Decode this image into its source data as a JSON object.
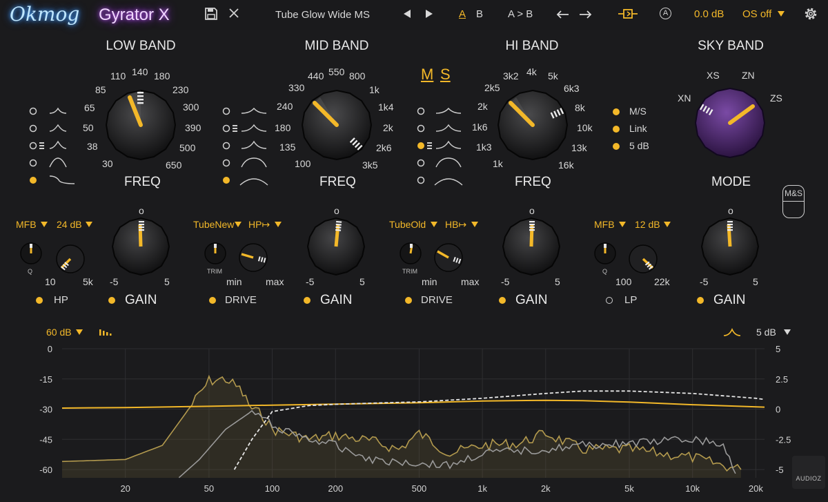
{
  "header": {
    "logo": "Okmog",
    "product": "Gyrator X",
    "preset": "Tube Glow Wide MS",
    "ab_a": "A",
    "ab_b": "B",
    "ab_copy": "A > B",
    "output": "0.0 dB",
    "os": "OS off",
    "auto_badge": "A"
  },
  "ms": {
    "m": "M",
    "s": "S"
  },
  "low": {
    "title": "LOW BAND",
    "freq_label": "FREQ",
    "freq_ticks": [
      "30",
      "38",
      "50",
      "65",
      "85",
      "110",
      "140",
      "180",
      "230",
      "300",
      "390",
      "500",
      "650"
    ],
    "filter_mode": "MFB",
    "slope": "24 dB",
    "hp_min": "10",
    "hp_max": "5k",
    "q_label": "Q",
    "hp_label": "HP",
    "gain_label": "GAIN",
    "gain_min": "-5",
    "gain_max": "5",
    "gain_center": "o"
  },
  "mid": {
    "title": "MID BAND",
    "freq_label": "FREQ",
    "freq_ticks": [
      "100",
      "135",
      "180",
      "240",
      "330",
      "440",
      "550",
      "800",
      "1k",
      "1k4",
      "2k",
      "2k6",
      "3k5"
    ],
    "tube": "TubeNew",
    "hp_mode": "HP↦",
    "trim": "TRIM",
    "drive_min": "min",
    "drive_max": "max",
    "drive_label": "DRIVE",
    "gain_label": "GAIN",
    "gain_min": "-5",
    "gain_max": "5",
    "gain_center": "o"
  },
  "hi": {
    "title": "HI BAND",
    "freq_label": "FREQ",
    "freq_ticks": [
      "1k",
      "1k3",
      "1k6",
      "2k",
      "2k5",
      "3k2",
      "4k",
      "5k",
      "6k3",
      "8k",
      "10k",
      "13k",
      "16k"
    ],
    "tube": "TubeOld",
    "hb_mode": "HB↦",
    "trim": "TRIM",
    "drive_min": "min",
    "drive_max": "max",
    "drive_label": "DRIVE",
    "gain_label": "GAIN",
    "gain_min": "-5",
    "gain_max": "5",
    "gain_center": "o"
  },
  "sky": {
    "title": "SKY BAND",
    "mode_label": "MODE",
    "modes": [
      "XN",
      "XS",
      "ZN",
      "ZS"
    ],
    "opts": [
      "M/S",
      "Link",
      "5 dB"
    ],
    "filter_mode": "MFB",
    "slope": "12 dB",
    "lp_min": "100",
    "lp_max": "22k",
    "q_label": "Q",
    "lp_label": "LP",
    "gain_label": "GAIN",
    "gain_min": "-5",
    "gain_max": "5",
    "gain_center": "o"
  },
  "ms_button": {
    "m": "M",
    "amp": "&",
    "s": "S"
  },
  "graph": {
    "range": "60 dB",
    "eq_range": "5 dB",
    "watermark": "AUDIOZ"
  },
  "chart_data": {
    "type": "line",
    "title": "",
    "xlabel": "",
    "ylabel": "",
    "x_scale": "log",
    "x_ticks": [
      "20",
      "50",
      "100",
      "200",
      "500",
      "1k",
      "2k",
      "5k",
      "10k",
      "20k"
    ],
    "y_left_ticks": [
      "0",
      "-15",
      "-30",
      "-45",
      "-60"
    ],
    "y_right_ticks": [
      "5",
      "2.5",
      "0",
      "-2.5",
      "-5"
    ],
    "ylim_left": [
      -60,
      0
    ],
    "ylim_right": [
      -5,
      5
    ],
    "grid": true,
    "colors": {
      "eq_curve": "#f3b829",
      "spectrum_in": "#b39a4e",
      "spectrum_out": "#9a9a9a",
      "hp_curve": "#e6e6e6"
    },
    "series": [
      {
        "x": [
          10,
          20,
          50,
          100,
          200,
          500,
          1000,
          2000,
          3000,
          5000,
          10000,
          22000
        ],
        "y": [
          -29.5,
          -29.2,
          -28.6,
          -28.0,
          -27.5,
          -26.8,
          -26.0,
          -25.6,
          -25.8,
          -26.5,
          -27.8,
          -29.0
        ]
      },
      {
        "x": [
          10,
          20,
          30,
          40,
          50,
          60,
          70,
          80,
          90,
          100,
          150,
          200,
          300,
          400,
          500,
          700,
          1000,
          1500,
          2000,
          3000,
          5000,
          7000,
          10000,
          14000,
          17000
        ],
        "y": [
          -56,
          -55,
          -48,
          -30,
          -16,
          -15,
          -20,
          -30,
          -33,
          -40,
          -45,
          -43,
          -46,
          -50,
          -42,
          -52,
          -48,
          -47,
          -42,
          -50,
          -50,
          -52,
          -54,
          -58,
          -60
        ]
      },
      {
        "x": [
          36,
          45,
          60,
          80,
          100,
          150,
          200,
          300,
          500,
          700,
          1000,
          2000,
          3000,
          5000,
          10000,
          14000,
          16000
        ],
        "y": [
          -64,
          -55,
          -40,
          -31,
          -38,
          -45,
          -48,
          -55,
          -57,
          -58,
          -52,
          -50,
          -48,
          -47,
          -45,
          -48,
          -62
        ]
      },
      {
        "x": [
          66,
          80,
          100,
          150,
          200,
          300,
          500,
          1000,
          2000,
          3000,
          5000,
          10000,
          20000,
          22000
        ],
        "y": [
          -5,
          -2.5,
          -0.2,
          0.3,
          0.4,
          0.5,
          0.6,
          0.9,
          1.3,
          1.5,
          1.5,
          1.3,
          0.9,
          0.8
        ]
      }
    ]
  }
}
